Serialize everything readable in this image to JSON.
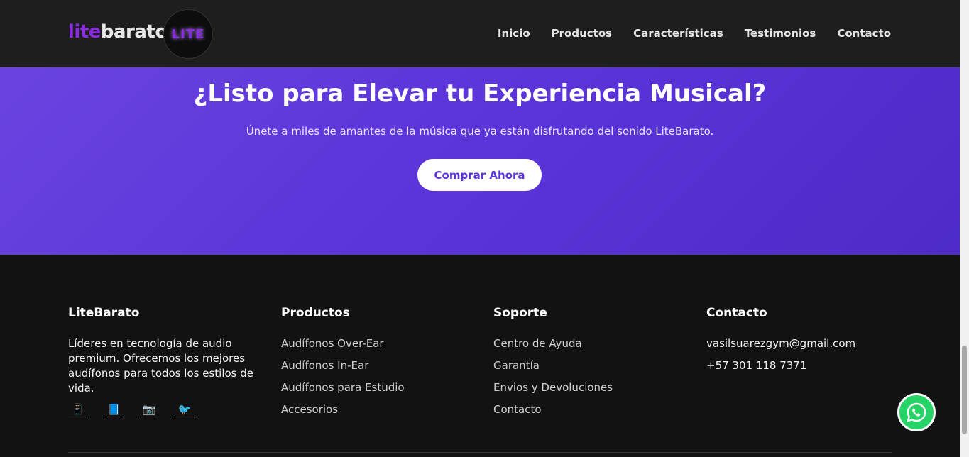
{
  "header": {
    "logo_lite": "lite",
    "logo_barato": "barato",
    "badge": "LITE",
    "nav": [
      "Inicio",
      "Productos",
      "Características",
      "Testimonios",
      "Contacto"
    ]
  },
  "cta": {
    "title": "¿Listo para Elevar tu Experiencia Musical?",
    "subtitle": "Únete a miles de amantes de la música que ya están disfrutando del sonido LiteBarato.",
    "button": "Comprar Ahora"
  },
  "footer": {
    "brand": {
      "title": "LiteBarato",
      "description": "Líderes en tecnología de audio premium. Ofrecemos los mejores audífonos para todos los estilos de vida.",
      "social_icons": [
        "📱",
        "📘",
        "📷",
        "🐦"
      ]
    },
    "productos": {
      "title": "Productos",
      "items": [
        "Audífonos Over-Ear",
        "Audífonos In-Ear",
        "Audífonos para Estudio",
        "Accesorios"
      ]
    },
    "soporte": {
      "title": "Soporte",
      "items": [
        "Centro de Ayuda",
        "Garantía",
        "Envios y Devoluciones",
        "Contacto"
      ]
    },
    "contacto": {
      "title": "Contacto",
      "email": "vasilsuarezgym@gmail.com",
      "phone": "+57 301 118 7371"
    }
  },
  "colors": {
    "brand_purple": "#8a2be2",
    "cta_gradient_start": "#6a43e0",
    "cta_gradient_end": "#4e2bc8",
    "whatsapp": "#25d366"
  }
}
